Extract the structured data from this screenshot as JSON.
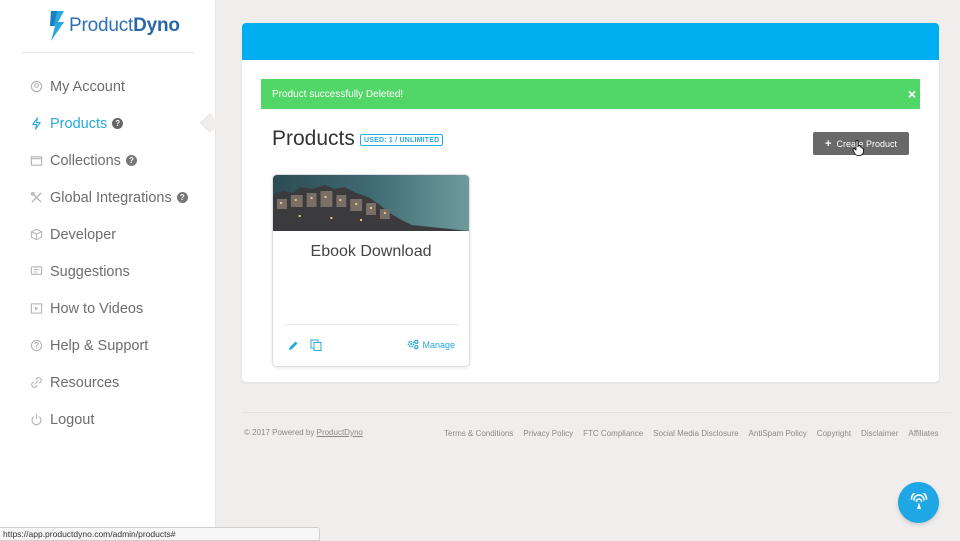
{
  "brand": {
    "name_part1": "Product",
    "name_part2": "Dyno",
    "color": "#2f6fb6"
  },
  "sidebar": {
    "items": [
      {
        "label": "My Account",
        "icon": "user-icon",
        "help": false,
        "active": false
      },
      {
        "label": "Products",
        "icon": "bolt-icon",
        "help": true,
        "active": true
      },
      {
        "label": "Collections",
        "icon": "folder-icon",
        "help": true,
        "active": false
      },
      {
        "label": "Global Integrations",
        "icon": "tools-icon",
        "help": true,
        "active": false
      },
      {
        "label": "Developer",
        "icon": "cube-icon",
        "help": false,
        "active": false
      },
      {
        "label": "Suggestions",
        "icon": "comment-icon",
        "help": false,
        "active": false
      },
      {
        "label": "How to Videos",
        "icon": "video-icon",
        "help": false,
        "active": false
      },
      {
        "label": "Help & Support",
        "icon": "question-circle-icon",
        "help": false,
        "active": false
      },
      {
        "label": "Resources",
        "icon": "link-icon",
        "help": false,
        "active": false
      },
      {
        "label": "Logout",
        "icon": "power-icon",
        "help": false,
        "active": false
      }
    ],
    "help_glyph": "?"
  },
  "main": {
    "alert": {
      "message": "Product successfully Deleted!",
      "close_glyph": "×"
    },
    "title": "Products",
    "usage_badge": "USED: 1 / UNLIMITED",
    "create_button": {
      "plus": "+",
      "label": "Create Product"
    },
    "cards": [
      {
        "title": "Ebook Download",
        "manage_label": "Manage"
      }
    ]
  },
  "footer": {
    "copyright_prefix": "© 2017 Powered by ",
    "copyright_link": "ProductDyno",
    "links": [
      "Terms & Conditions",
      "Privacy Policy",
      "FTC Compliance",
      "Social Media Disclosure",
      "AntiSpam Policy",
      "Copyright",
      "Disclaimer",
      "Affiliates"
    ]
  },
  "status_bar": {
    "url": "https://app.productdyno.com/admin/products#"
  },
  "colors": {
    "accent": "#00aeef",
    "link": "#27a9df",
    "success": "#52d667",
    "button": "#696969"
  }
}
